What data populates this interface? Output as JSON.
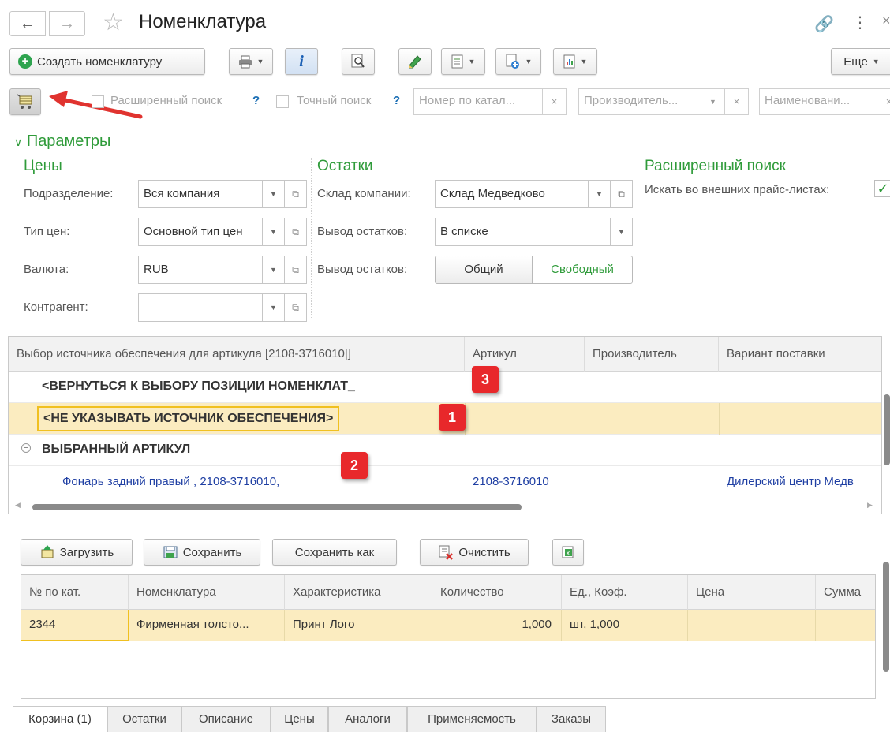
{
  "window": {
    "title": "Номенклатура"
  },
  "toolbar": {
    "create_label": "Создать номенклатуру",
    "more_label": "Еще"
  },
  "search": {
    "extended_label": "Расширенный поиск",
    "exact_label": "Точный поиск",
    "question": "?",
    "catalog_placeholder": "Номер по катал...",
    "manufacturer_placeholder": "Производитель...",
    "name_placeholder": "Наименовани..."
  },
  "params": {
    "header": "Параметры",
    "prices": {
      "title": "Цены",
      "division_label": "Подразделение:",
      "division_value": "Вся компания",
      "price_type_label": "Тип цен:",
      "price_type_value": "Основной тип цен",
      "currency_label": "Валюта:",
      "currency_value": "RUB",
      "contractor_label": "Контрагент:",
      "contractor_value": ""
    },
    "stock": {
      "title": "Остатки",
      "warehouse_label": "Склад компании:",
      "warehouse_value": "Склад Медведково",
      "output_label": "Вывод остатков:",
      "output_value": "В списке",
      "output2_label": "Вывод остатков:",
      "toggle_general": "Общий",
      "toggle_free": "Свободный"
    },
    "ext": {
      "title": "Расширенный поиск",
      "external_label": "Искать во внешних прайс-листах:"
    }
  },
  "grid": {
    "headers": [
      "Выбор источника обеспечения для артикула [2108-3716010|]",
      "Артикул",
      "Производитель",
      "Вариант поставки"
    ],
    "row_back": "<ВЕРНУТЬСЯ К ВЫБОРУ ПОЗИЦИИ НОМЕНКЛАТ_",
    "row_none": "<НЕ УКАЗЫВАТЬ ИСТОЧНИК ОБЕСПЕЧЕНИЯ>",
    "group_label": "ВЫБРАННЫЙ АРТИКУЛ",
    "item_name": "Фонарь задний правый , 2108-3716010,",
    "item_article": "2108-3716010",
    "item_variant": "Дилерский центр Медв",
    "badges": [
      "1",
      "2",
      "3"
    ]
  },
  "cart": {
    "load_label": "Загрузить",
    "save_label": "Сохранить",
    "saveas_label": "Сохранить как",
    "clear_label": "Очистить",
    "headers": [
      "№ по кат.",
      "Номенклатура",
      "Характеристика",
      "Количество",
      "Ед., Коэф.",
      "Цена",
      "Сумма"
    ],
    "row": [
      "2344",
      "Фирменная толсто...",
      "Принт Лого",
      "1,000",
      "шт, 1,000",
      "",
      ""
    ]
  },
  "tabs": [
    "Корзина (1)",
    "Остатки",
    "Описание",
    "Цены",
    "Аналоги",
    "Применяемость",
    "Заказы"
  ]
}
